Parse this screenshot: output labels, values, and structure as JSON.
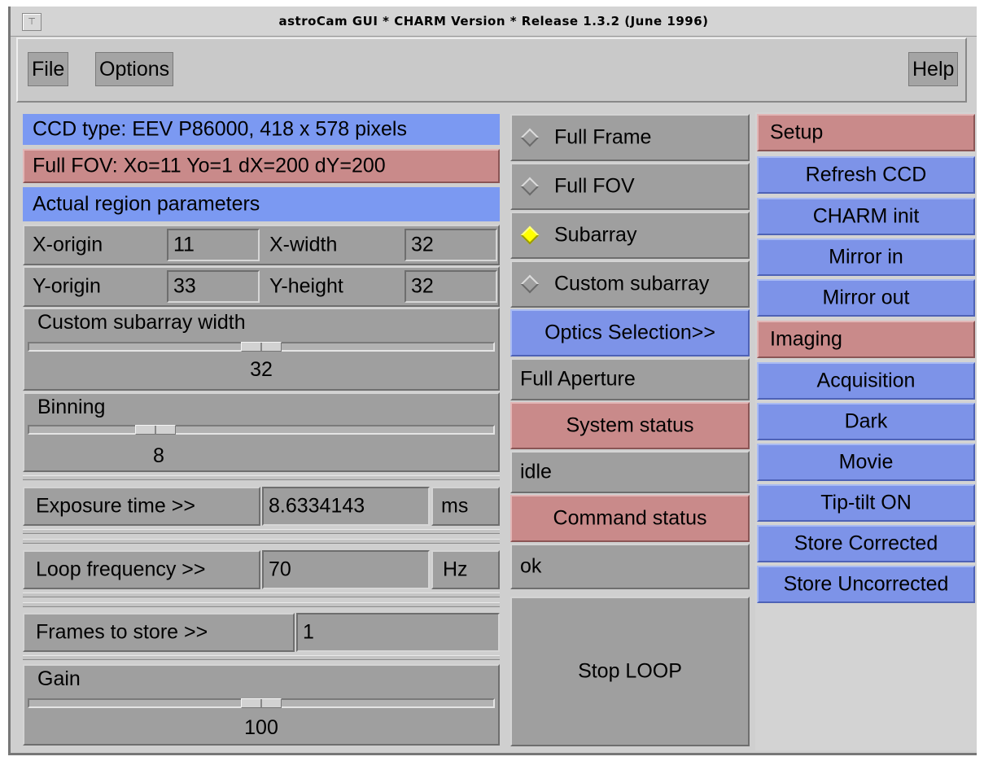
{
  "window": {
    "title": "astroCam GUI * CHARM Version * Release 1.3.2 (June 1996)",
    "menu_glyph": "⊤"
  },
  "menubar": {
    "file": "File",
    "options": "Options",
    "help": "Help"
  },
  "left": {
    "ccd_type": "CCD type: EEV P86000, 418 x 578 pixels",
    "full_fov": "Full FOV: Xo=11 Yo=1 dX=200 dY=200",
    "region_header": "Actual region parameters",
    "x_origin_label": "X-origin",
    "x_origin_value": "11",
    "x_width_label": "X-width",
    "x_width_value": "32",
    "y_origin_label": "Y-origin",
    "y_origin_value": "33",
    "y_height_label": "Y-height",
    "y_height_value": "32",
    "custom_width": {
      "label": "Custom subarray width",
      "value": "32",
      "position": 0.5
    },
    "binning": {
      "label": "Binning",
      "value": "8",
      "position": 0.25
    },
    "exposure": {
      "label": "Exposure time >>",
      "value": "8.6334143",
      "unit": "ms"
    },
    "loop": {
      "label": "Loop frequency >>",
      "value": "70",
      "unit": "Hz"
    },
    "frames": {
      "label": "Frames to store >>",
      "value": "1"
    },
    "gain": {
      "label": "Gain",
      "value": "100",
      "position": 0.5
    }
  },
  "middle": {
    "full_frame": "Full Frame",
    "full_fov": "Full FOV",
    "subarray": "Subarray",
    "custom_subarray": "Custom subarray",
    "selected_mode": "Subarray",
    "optics_button": "Optics Selection>>",
    "optics_value": "Full Aperture",
    "system_status_label": "System status",
    "system_status_value": "idle",
    "command_status_label": "Command status",
    "command_status_value": "ok",
    "stop_loop": "Stop LOOP"
  },
  "right": {
    "setup": "Setup",
    "refresh_ccd": "Refresh CCD",
    "charm_init": "CHARM init",
    "mirror_in": "Mirror in",
    "mirror_out": "Mirror out",
    "imaging": "Imaging",
    "acquisition": "Acquisition",
    "dark": "Dark",
    "movie": "Movie",
    "tip_tilt": "Tip-tilt ON",
    "store_corrected": "Store Corrected",
    "store_uncorrected": "Store Uncorrected"
  },
  "colors": {
    "blue": "#7b99f2",
    "pink": "#c98a8a",
    "panel_grey": "#9f9f9f",
    "selected_radio": "#ffff00"
  }
}
